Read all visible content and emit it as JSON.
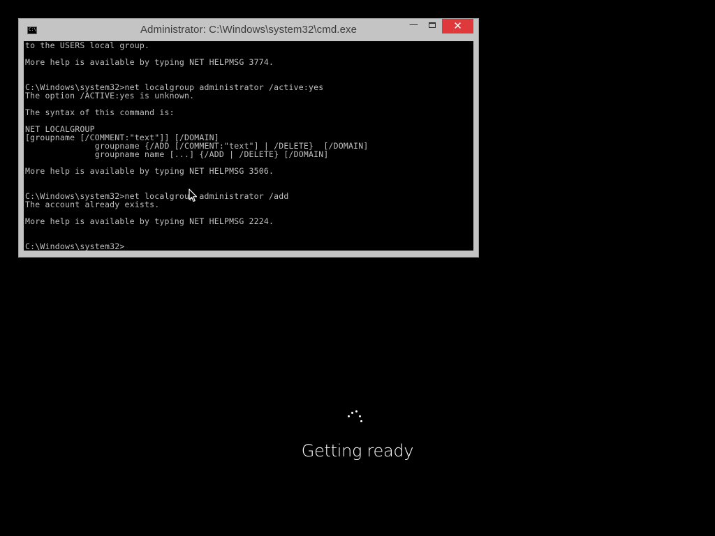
{
  "window": {
    "title": "Administrator: C:\\Windows\\system32\\cmd.exe",
    "app_icon": "console-icon",
    "app_icon_text": "C:\\",
    "controls": {
      "minimize_glyph": "—",
      "maximize_icon": "maximize-icon",
      "close_glyph": "✕"
    },
    "close_color": "#e0393b"
  },
  "console": {
    "background": "#000000",
    "foreground": "#c0c0c0",
    "text": "to the USERS local group.\n\nMore help is available by typing NET HELPMSG 3774.\n\n\nC:\\Windows\\system32>net localgroup administrator /active:yes\nThe option /ACTIVE:yes is unknown.\n\nThe syntax of this command is:\n\nNET LOCALGROUP\n[groupname [/COMMENT:\"text\"]] [/DOMAIN]\n              groupname {/ADD [/COMMENT:\"text\"] | /DELETE}  [/DOMAIN]\n              groupname name [...] {/ADD | /DELETE} [/DOMAIN]\n\nMore help is available by typing NET HELPMSG 3506.\n\n\nC:\\Windows\\system32>net localgroup administrator /add\nThe account already exists.\n\nMore help is available by typing NET HELPMSG 2224.\n\n\nC:\\Windows\\system32>"
  },
  "cursor": {
    "icon": "arrow-cursor-icon"
  },
  "boot": {
    "spinner_icon": "loading-spinner-icon",
    "status": "Getting ready"
  }
}
